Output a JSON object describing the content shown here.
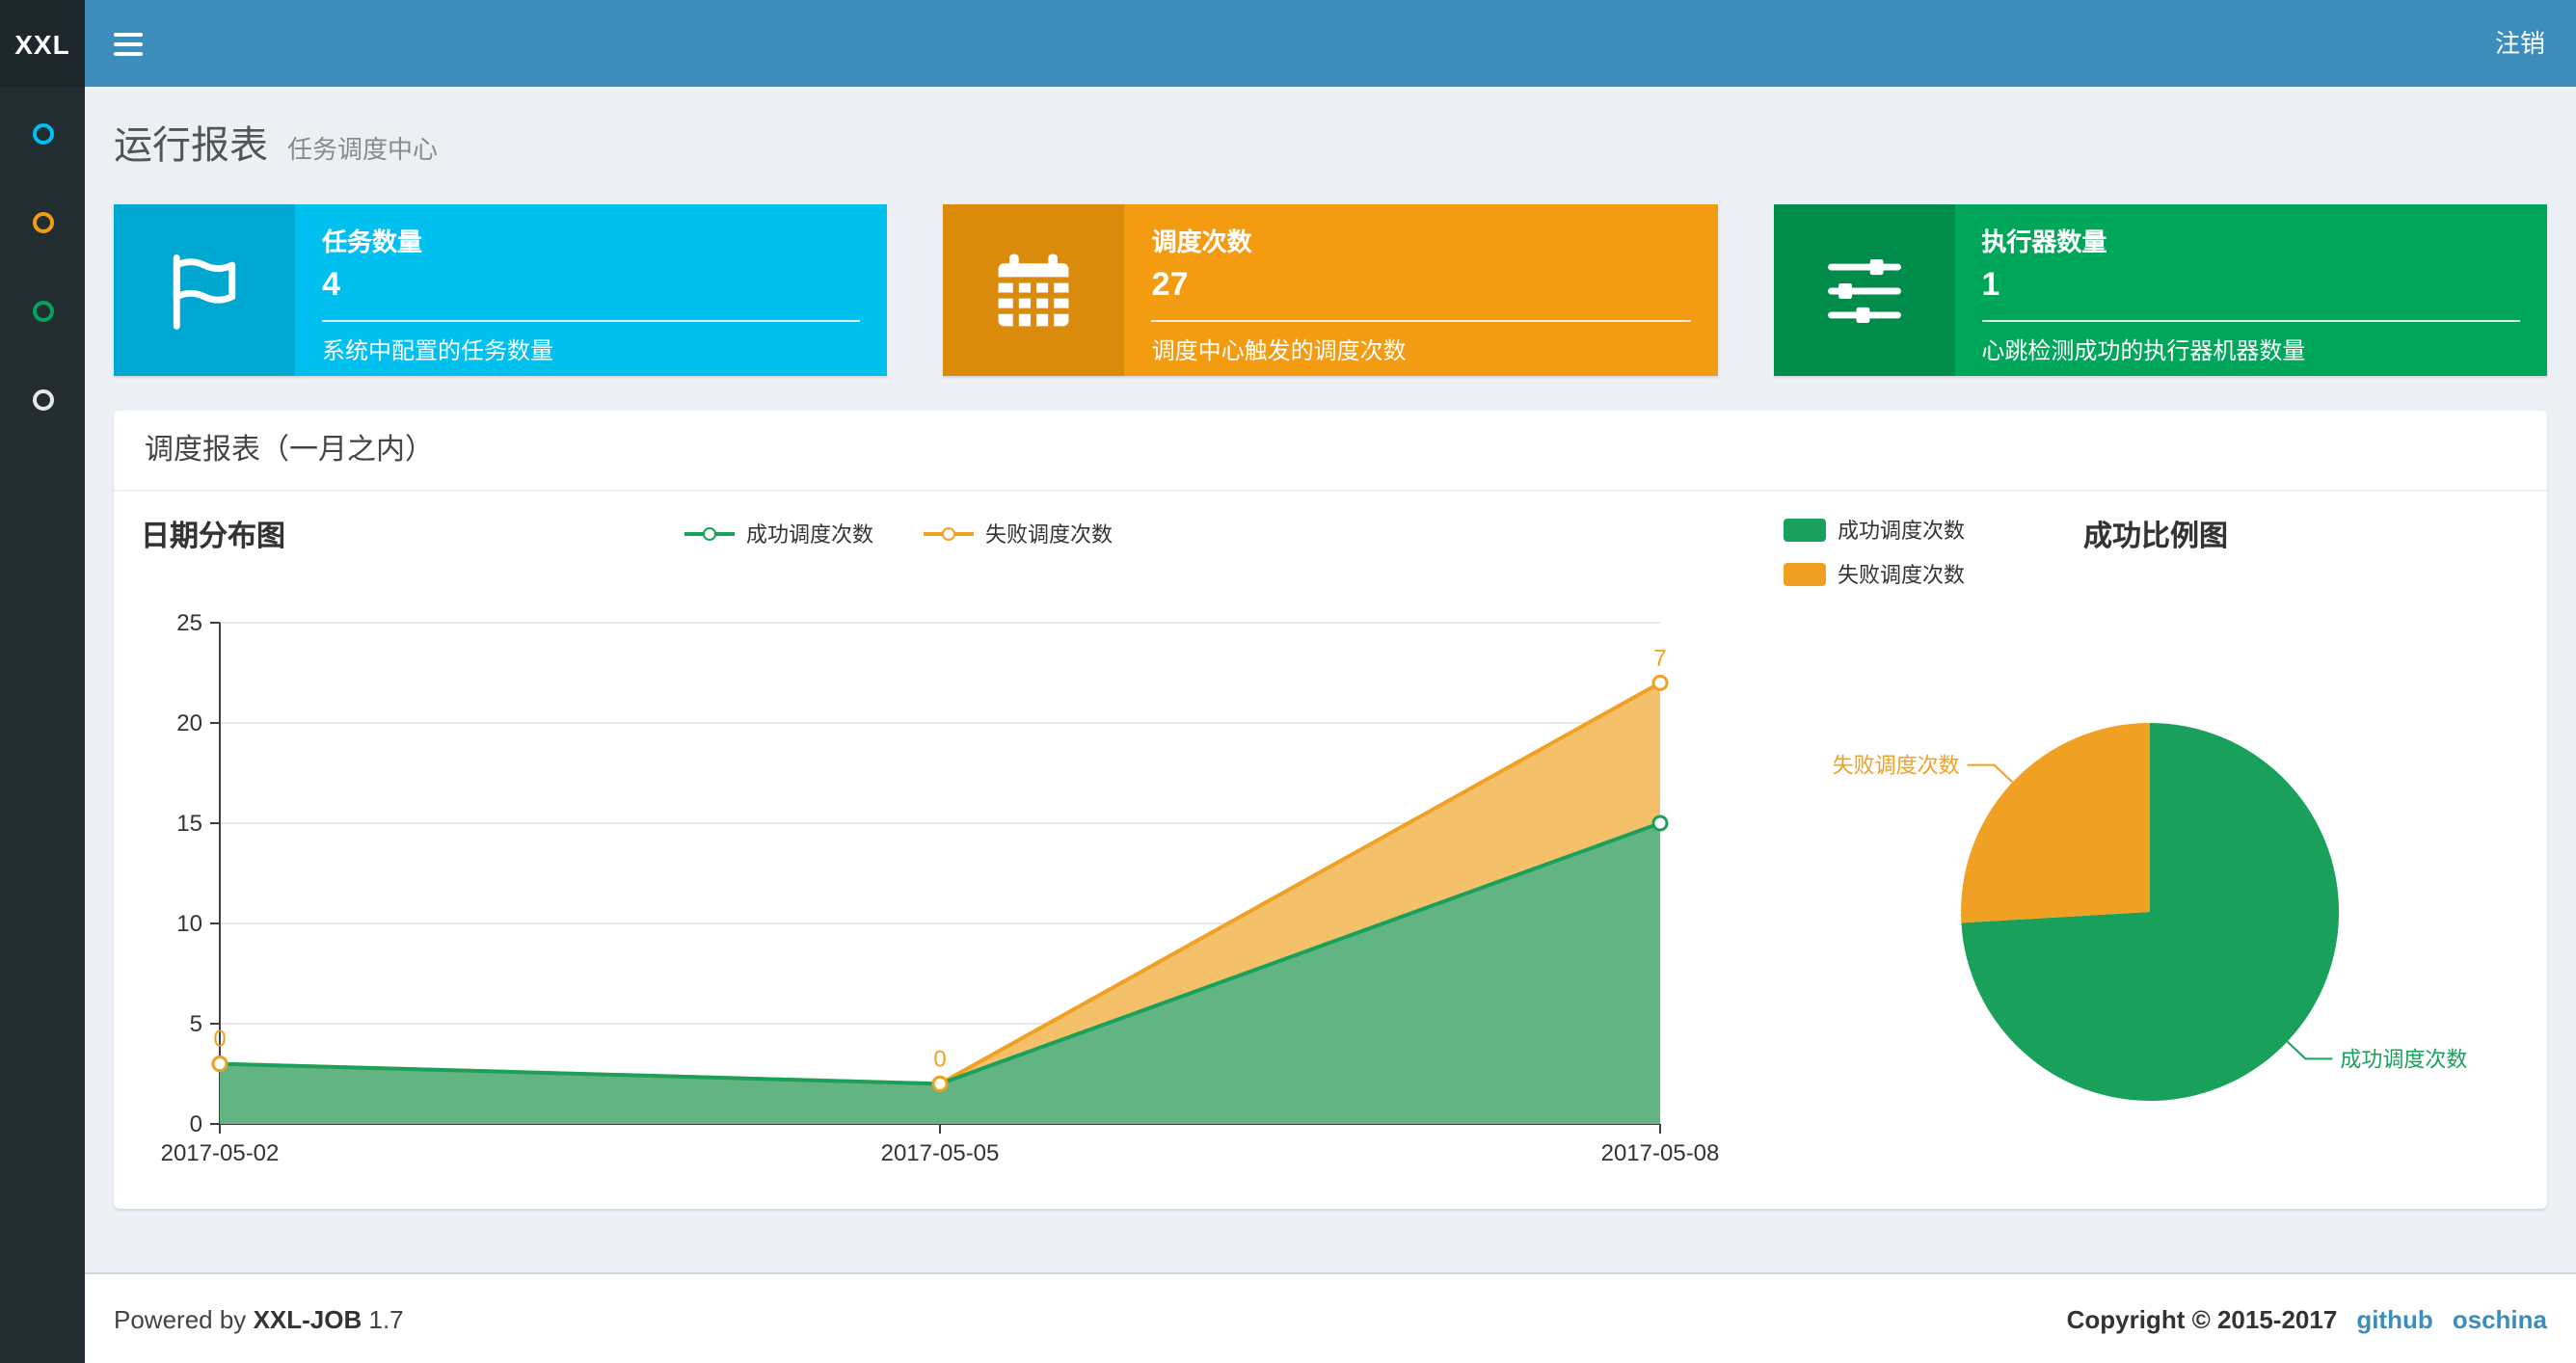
{
  "header": {
    "logo_text": "XXL",
    "logout_label": "注销"
  },
  "sidebar": {
    "items": [
      {
        "color": "#00c0ef"
      },
      {
        "color": "#f39c12"
      },
      {
        "color": "#00a65a"
      },
      {
        "color": "#e8e8e8"
      }
    ]
  },
  "page": {
    "title": "运行报表",
    "subtitle": "任务调度中心"
  },
  "info_boxes": [
    {
      "title": "任务数量",
      "value": "4",
      "desc": "系统中配置的任务数量",
      "color": "#00c0ef",
      "color_dark": "#00a7d0",
      "icon": "flag-icon"
    },
    {
      "title": "调度次数",
      "value": "27",
      "desc": "调度中心触发的调度次数",
      "color": "#f39c12",
      "color_dark": "#db8b0b",
      "icon": "calendar-icon"
    },
    {
      "title": "执行器数量",
      "value": "1",
      "desc": "心跳检测成功的执行器机器数量",
      "color": "#00a65a",
      "color_dark": "#008d4c",
      "icon": "sliders-icon"
    }
  ],
  "panel": {
    "title": "调度报表（一月之内）"
  },
  "chart_data": [
    {
      "type": "area",
      "title": "日期分布图",
      "stacked": true,
      "x": [
        "2017-05-02",
        "2017-05-05",
        "2017-05-08"
      ],
      "series": [
        {
          "name": "成功调度次数",
          "values": [
            3,
            2,
            15
          ],
          "color": "#19a05b",
          "fill": "#62b583"
        },
        {
          "name": "失败调度次数",
          "values": [
            0,
            0,
            7
          ],
          "color": "#f0a022",
          "fill": "#f4c06a",
          "show_point_labels": true
        }
      ],
      "ylim": [
        0,
        25
      ],
      "ytick_step": 5,
      "grid": true,
      "legend_position": "top-center"
    },
    {
      "type": "pie",
      "title": "成功比例图",
      "slices": [
        {
          "label": "成功调度次数",
          "value": 20,
          "color": "#19a05b"
        },
        {
          "label": "失败调度次数",
          "value": 7,
          "color": "#f0a022"
        }
      ],
      "start_angle": 90,
      "clockwise": true,
      "legend_position": "top-left"
    }
  ],
  "footer": {
    "powered_prefix": "Powered by",
    "brand": "XXL-JOB",
    "version": "1.7",
    "copyright": "Copyright © 2015-2017",
    "links": [
      {
        "label": "github"
      },
      {
        "label": "oschina"
      }
    ]
  }
}
